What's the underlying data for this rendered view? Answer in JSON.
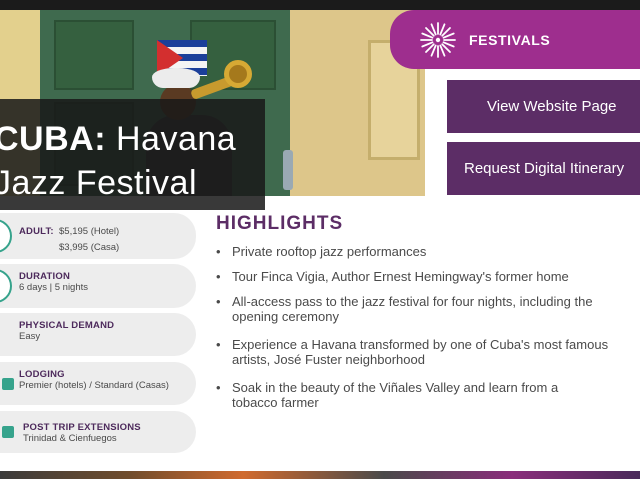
{
  "header": {
    "title_bold": "CUBA:",
    "title_rest": "Havana",
    "title_line2": "Jazz Festival"
  },
  "badge": {
    "label": "FESTIVALS",
    "icon": "firework-icon",
    "color": "#9e2e8e"
  },
  "buttons": {
    "view_website": "View Website Page",
    "request_itinerary": "Request Digital Itinerary"
  },
  "info": {
    "adult_label": "ADULT:",
    "adult_hotel": "$5,195 (Hotel)",
    "adult_casa": "$3,995 (Casa)",
    "duration_label": "DURATION",
    "duration_value": "6 days | 5 nights",
    "physical_label": "PHYSICAL DEMAND",
    "physical_value": "Easy",
    "lodging_label": "LODGING",
    "lodging_value": "Premier (hotels) / Standard (Casas)",
    "extensions_label": "POST TRIP EXTENSIONS",
    "extensions_value": "Trinidad & Cienfuegos"
  },
  "highlights": {
    "title": "HIGHLIGHTS",
    "items": [
      "Private rooftop jazz performances",
      "Tour Finca Vigia, Author Ernest Hemingway's former home",
      [
        "All-access pass to the jazz festival for four nights, including the",
        "opening ceremony"
      ],
      [
        "Experience a Havana transformed by one of Cuba's most famous",
        "artists, José Fuster neighborhood"
      ],
      [
        "Soak in the beauty of the Viñales Valley and learn from a",
        "tobacco farmer"
      ]
    ]
  },
  "colors": {
    "primary_purple": "#5c2d66",
    "accent_teal": "#36a38c",
    "pill_bg": "#ededed"
  }
}
